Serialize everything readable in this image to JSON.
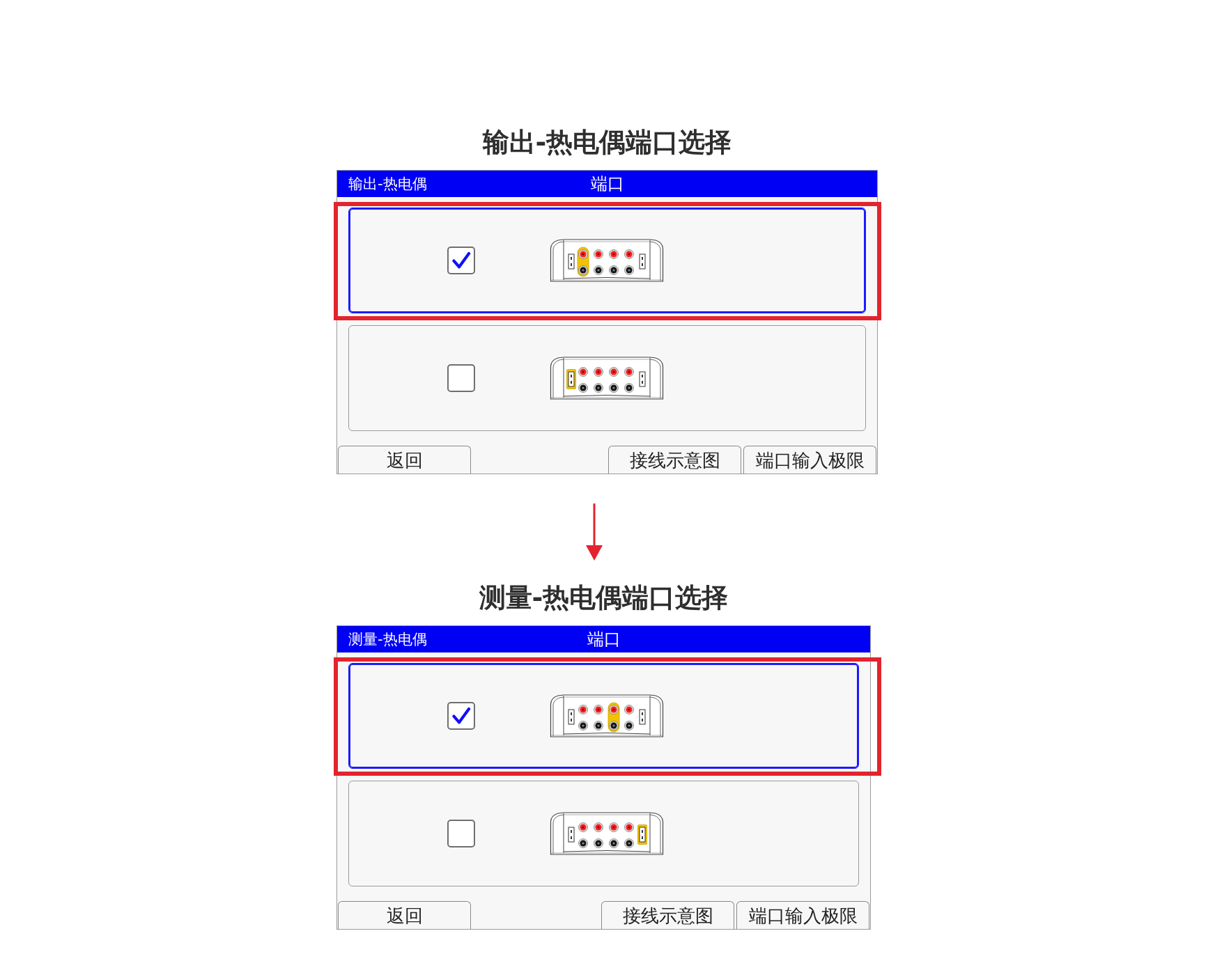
{
  "sections": [
    {
      "title": "输出-热电偶端口选择",
      "window": {
        "mode": "输出-热电偶",
        "title": "端口"
      },
      "options": [
        {
          "selected": true,
          "checked": true,
          "highlighted": true,
          "terminals": [
            {
              "kind": "connector",
              "selected": false
            },
            {
              "kind": "jack",
              "selected": true
            },
            {
              "kind": "jack",
              "selected": false
            },
            {
              "kind": "jack",
              "selected": false
            },
            {
              "kind": "jack",
              "selected": false
            },
            {
              "kind": "connector",
              "selected": false
            }
          ]
        },
        {
          "selected": false,
          "checked": false,
          "highlighted": false,
          "terminals": [
            {
              "kind": "connector",
              "selected": true
            },
            {
              "kind": "jack",
              "selected": false
            },
            {
              "kind": "jack",
              "selected": false
            },
            {
              "kind": "jack",
              "selected": false
            },
            {
              "kind": "jack",
              "selected": false
            },
            {
              "kind": "connector",
              "selected": false
            }
          ]
        }
      ],
      "back_button": "返回",
      "buttons": [
        "接线示意图",
        "端口输入极限"
      ]
    },
    {
      "title": "测量-热电偶端口选择",
      "window": {
        "mode": "测量-热电偶",
        "title": "端口"
      },
      "options": [
        {
          "selected": true,
          "checked": true,
          "highlighted": true,
          "terminals": [
            {
              "kind": "connector",
              "selected": false
            },
            {
              "kind": "jack",
              "selected": false
            },
            {
              "kind": "jack",
              "selected": false
            },
            {
              "kind": "jack",
              "selected": true
            },
            {
              "kind": "jack",
              "selected": false
            },
            {
              "kind": "connector",
              "selected": false
            }
          ]
        },
        {
          "selected": false,
          "checked": false,
          "highlighted": false,
          "terminals": [
            {
              "kind": "connector",
              "selected": false
            },
            {
              "kind": "jack",
              "selected": false
            },
            {
              "kind": "jack",
              "selected": false
            },
            {
              "kind": "jack",
              "selected": false
            },
            {
              "kind": "jack",
              "selected": false
            },
            {
              "kind": "connector",
              "selected": true
            }
          ]
        }
      ],
      "back_button": "返回",
      "buttons": [
        "接线示意图",
        "端口输入极限"
      ]
    }
  ]
}
